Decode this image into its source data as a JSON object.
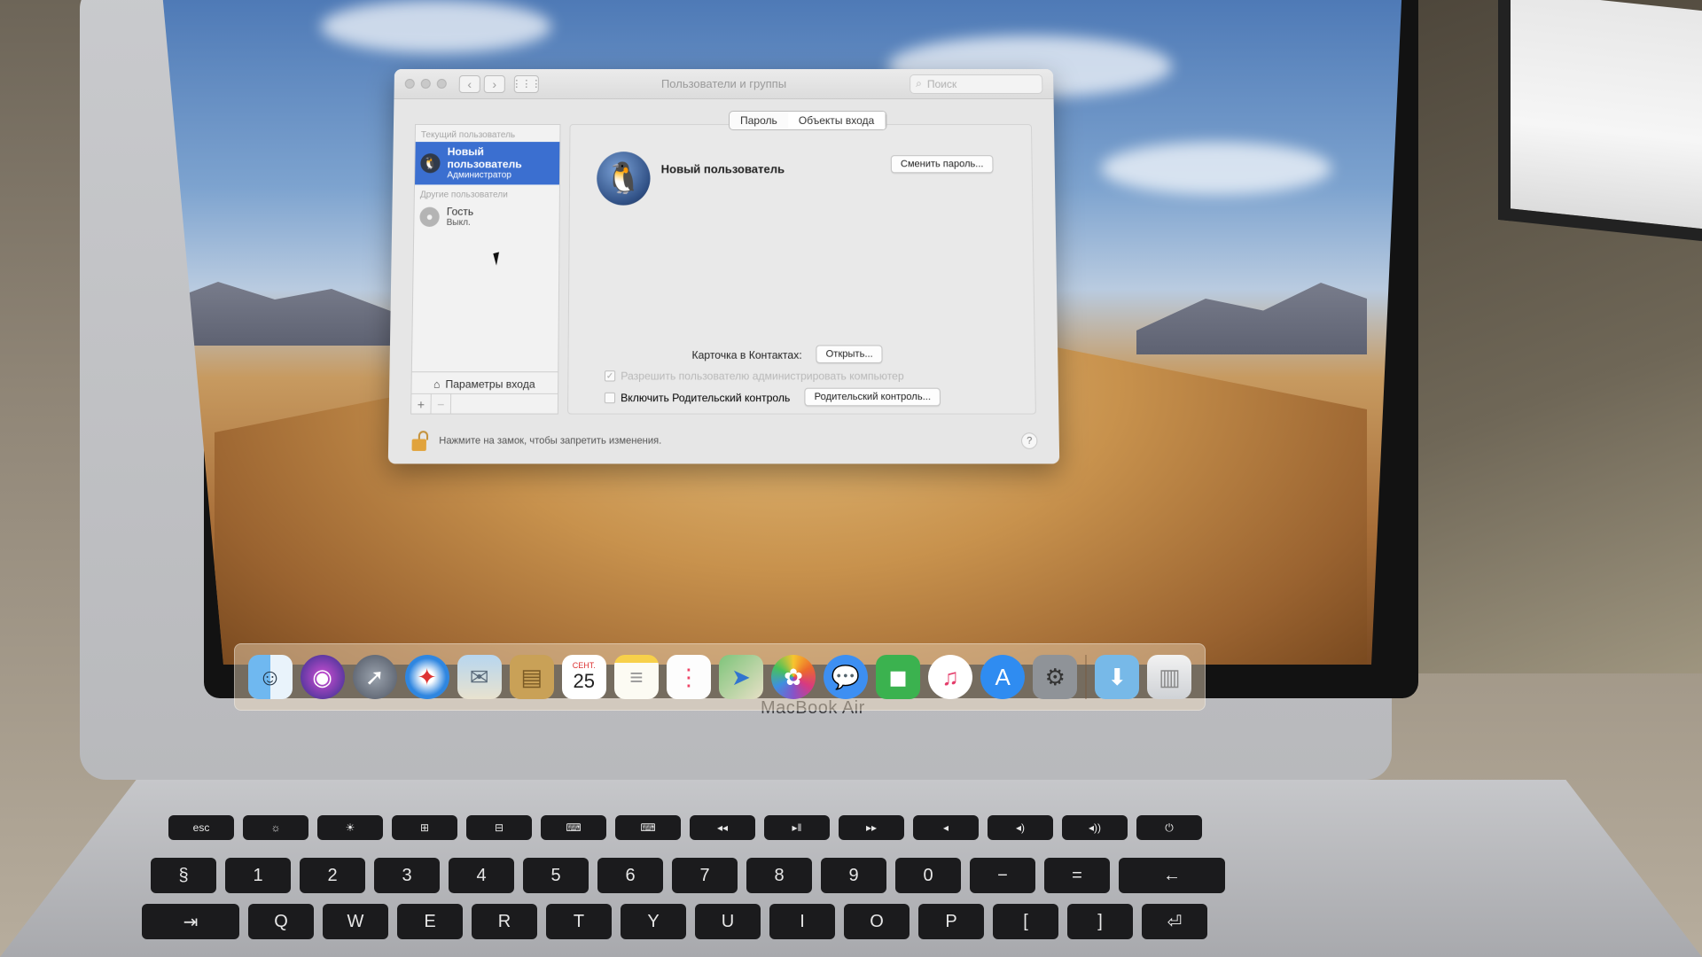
{
  "window": {
    "title": "Пользователи и группы",
    "search_placeholder": "Поиск",
    "nav_back": "‹",
    "nav_forward": "›",
    "grid": "⋮⋮⋮"
  },
  "sidebar": {
    "current_user_label": "Текущий пользователь",
    "current_user": {
      "name": "Новый пользователь",
      "role": "Администратор"
    },
    "other_users_label": "Другие пользователи",
    "guest": {
      "name": "Гость",
      "status": "Выкл."
    },
    "login_options": "Параметры входа",
    "add": "+",
    "remove": "−"
  },
  "tabs": [
    {
      "label": "Пароль",
      "active": false
    },
    {
      "label": "Объекты входа",
      "active": true
    }
  ],
  "panel": {
    "full_name": "Новый пользователь",
    "change_password_button": "Сменить пароль...",
    "contacts_card_label": "Карточка в Контактах:",
    "open_button": "Открыть...",
    "allow_admin_label": "Разрешить пользователю администрировать компьютер",
    "allow_admin_checked": true,
    "parental_label": "Включить Родительский контроль",
    "parental_checked": false,
    "parental_button": "Родительский контроль..."
  },
  "footer": {
    "lock_text": "Нажмите на замок, чтобы запретить изменения.",
    "help": "?"
  },
  "dock": {
    "icons": [
      "finder-icon",
      "siri-icon",
      "launchpad-icon",
      "safari-icon",
      "mail-icon",
      "contacts-icon",
      "calendar-icon",
      "notes-icon",
      "reminders-icon",
      "maps-icon",
      "photos-icon",
      "messages-icon",
      "facetime-icon",
      "itunes-icon",
      "app-store-icon",
      "system-preferences-icon",
      "downloads-folder-icon",
      "trash-icon"
    ],
    "calendar_month": "СЕНТ.",
    "calendar_day": "25"
  },
  "device": {
    "brand": "MacBook Air"
  },
  "colors": {
    "selection_blue": "#3b6fd0",
    "lock_gold": "#e1a33c"
  }
}
